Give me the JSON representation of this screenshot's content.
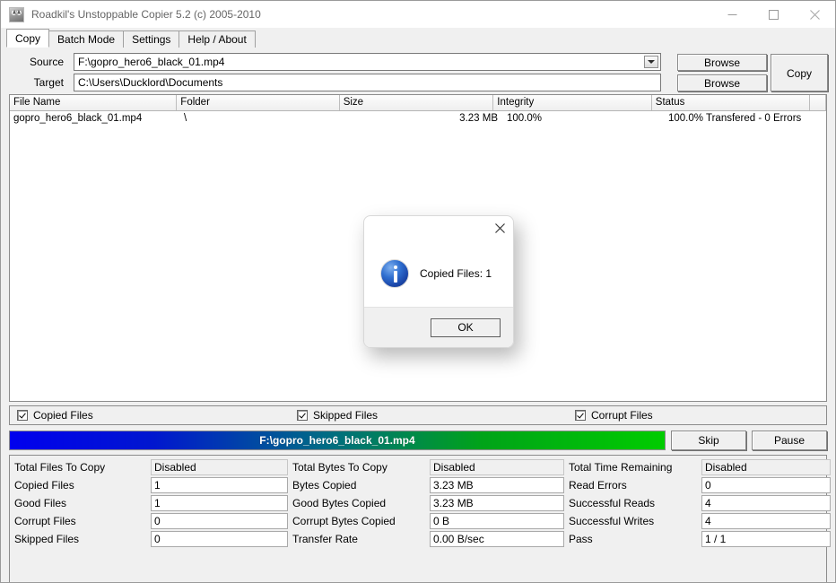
{
  "window": {
    "title": "Roadkil's Unstoppable Copier 5.2 (c) 2005-2010",
    "app_icon": "app-icon",
    "minimize_glyph": "─",
    "maximize_glyph": "□",
    "close_glyph": "✕"
  },
  "tabs": [
    {
      "label": "Copy",
      "active": true
    },
    {
      "label": "Batch Mode",
      "active": false
    },
    {
      "label": "Settings",
      "active": false
    },
    {
      "label": "Help / About",
      "active": false
    }
  ],
  "form": {
    "source_label": "Source",
    "source_value": "F:\\gopro_hero6_black_01.mp4",
    "target_label": "Target",
    "target_value": "C:\\Users\\Ducklord\\Documents",
    "browse_source_label": "Browse",
    "browse_target_label": "Browse",
    "copy_label": "Copy",
    "dropdown_icon": "chevron-down-icon"
  },
  "file_list": {
    "columns": [
      "File Name",
      "Folder",
      "Size",
      "Integrity",
      "Status"
    ],
    "rows": [
      {
        "file_name": "gopro_hero6_black_01.mp4",
        "folder": "\\",
        "size": "3.23 MB",
        "integrity": "100.0%",
        "status": "100.0% Transfered - 0 Errors"
      }
    ]
  },
  "filters": [
    {
      "label": "Copied Files",
      "checked": true
    },
    {
      "label": "Skipped Files",
      "checked": true
    },
    {
      "label": "Corrupt Files",
      "checked": true
    }
  ],
  "progress": {
    "label": "F:\\gopro_hero6_black_01.mp4",
    "percent": 100,
    "gradient_start": "#0000ee",
    "gradient_end": "#00cc00",
    "skip_label": "Skip",
    "pause_label": "Pause"
  },
  "stats": {
    "column_a": [
      {
        "label": "Total Files To Copy",
        "value": "Disabled",
        "disabled": true
      },
      {
        "label": "Copied Files",
        "value": "1",
        "disabled": false
      },
      {
        "label": "Good Files",
        "value": "1",
        "disabled": false
      },
      {
        "label": "Corrupt Files",
        "value": "0",
        "disabled": false
      },
      {
        "label": "Skipped Files",
        "value": "0",
        "disabled": false
      }
    ],
    "column_b": [
      {
        "label": "Total Bytes To Copy",
        "value": "Disabled",
        "disabled": true
      },
      {
        "label": "Bytes Copied",
        "value": "3.23 MB",
        "disabled": false
      },
      {
        "label": "Good Bytes Copied",
        "value": "3.23 MB",
        "disabled": false
      },
      {
        "label": "Corrupt Bytes Copied",
        "value": "0 B",
        "disabled": false
      },
      {
        "label": "Transfer Rate",
        "value": "0.00 B/sec",
        "disabled": false
      }
    ],
    "column_c": [
      {
        "label": "Total Time Remaining",
        "value": "Disabled",
        "disabled": true
      },
      {
        "label": "Read Errors",
        "value": "0",
        "disabled": false
      },
      {
        "label": "Successful Reads",
        "value": "4",
        "disabled": false
      },
      {
        "label": "Successful Writes",
        "value": "4",
        "disabled": false
      },
      {
        "label": "Pass",
        "value": "1 / 1",
        "disabled": false
      }
    ]
  },
  "dialog": {
    "message": "Copied Files: 1",
    "ok_label": "OK",
    "close_glyph": "✕",
    "icon": "info-icon"
  }
}
